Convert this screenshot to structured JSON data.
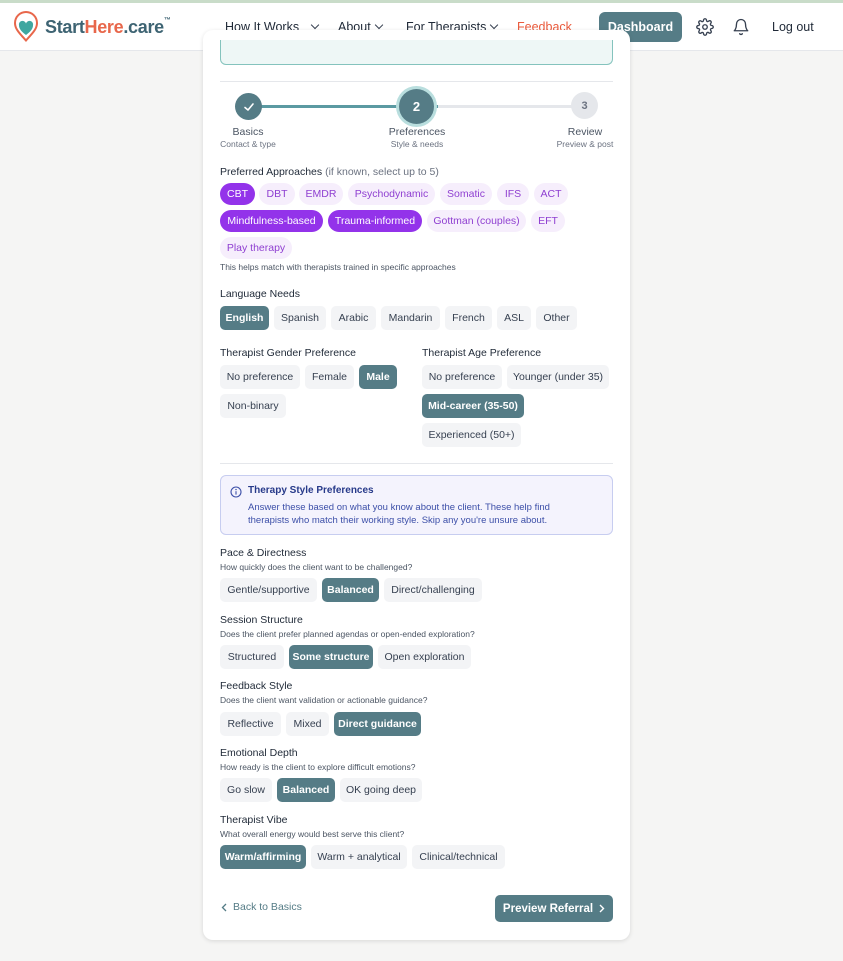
{
  "header": {
    "logo": {
      "start": "Start",
      "here": "Here",
      "care": ".care",
      "tm": "™"
    },
    "nav": {
      "how_it_works": "How It Works",
      "about": "About",
      "for_therapists": "For Therapists",
      "feedback": "Feedback",
      "dashboard": "Dashboard",
      "logout": "Log out"
    },
    "icons": {
      "settings": "gear-icon",
      "notifications": "bell-icon",
      "expand": "chevron-down-icon"
    }
  },
  "colors": {
    "brand_teal": "#557c86",
    "accent_coral": "#ea5a3c",
    "purple": "#9333ea"
  },
  "stepper": {
    "steps": [
      {
        "number": "1",
        "title": "Basics",
        "subtitle": "Contact & type",
        "state": "complete"
      },
      {
        "number": "2",
        "title": "Preferences",
        "subtitle": "Style & needs",
        "state": "active"
      },
      {
        "number": "3",
        "title": "Review",
        "subtitle": "Preview & post",
        "state": "upcoming"
      }
    ]
  },
  "approaches": {
    "label": "Preferred Approaches",
    "label_hint": "(if known, select up to 5)",
    "help": "This helps match with therapists trained in specific approaches",
    "options": [
      {
        "label": "CBT",
        "selected": true
      },
      {
        "label": "DBT",
        "selected": false
      },
      {
        "label": "EMDR",
        "selected": false
      },
      {
        "label": "Psychodynamic",
        "selected": false
      },
      {
        "label": "Somatic",
        "selected": false
      },
      {
        "label": "IFS",
        "selected": false
      },
      {
        "label": "ACT",
        "selected": false
      },
      {
        "label": "Mindfulness-based",
        "selected": true
      },
      {
        "label": "Trauma-informed",
        "selected": true
      },
      {
        "label": "Gottman (couples)",
        "selected": false
      },
      {
        "label": "EFT",
        "selected": false
      },
      {
        "label": "Play therapy",
        "selected": false
      }
    ]
  },
  "language": {
    "label": "Language Needs",
    "options": [
      {
        "label": "English",
        "selected": true
      },
      {
        "label": "Spanish",
        "selected": false
      },
      {
        "label": "Arabic",
        "selected": false
      },
      {
        "label": "Mandarin",
        "selected": false
      },
      {
        "label": "French",
        "selected": false
      },
      {
        "label": "ASL",
        "selected": false
      },
      {
        "label": "Other",
        "selected": false
      }
    ]
  },
  "gender": {
    "label": "Therapist Gender Preference",
    "options": [
      {
        "label": "No preference",
        "selected": false
      },
      {
        "label": "Female",
        "selected": false
      },
      {
        "label": "Male",
        "selected": true
      },
      {
        "label": "Non-binary",
        "selected": false
      }
    ]
  },
  "age": {
    "label": "Therapist Age Preference",
    "options": [
      {
        "label": "No preference",
        "selected": false
      },
      {
        "label": "Younger (under 35)",
        "selected": false
      },
      {
        "label": "Mid-career (35-50)",
        "selected": true
      },
      {
        "label": "Experienced (50+)",
        "selected": false
      }
    ]
  },
  "style_info": {
    "icon": "info-icon",
    "title": "Therapy Style Preferences",
    "body": "Answer these based on what you know about the client. These help find therapists who match their working style. Skip any you're unsure about."
  },
  "style_questions": [
    {
      "label": "Pace & Directness",
      "question": "How quickly does the client want to be challenged?",
      "options": [
        {
          "label": "Gentle/supportive",
          "selected": false
        },
        {
          "label": "Balanced",
          "selected": true
        },
        {
          "label": "Direct/challenging",
          "selected": false
        }
      ]
    },
    {
      "label": "Session Structure",
      "question": "Does the client prefer planned agendas or open-ended exploration?",
      "options": [
        {
          "label": "Structured",
          "selected": false
        },
        {
          "label": "Some structure",
          "selected": true
        },
        {
          "label": "Open exploration",
          "selected": false
        }
      ]
    },
    {
      "label": "Feedback Style",
      "question": "Does the client want validation or actionable guidance?",
      "options": [
        {
          "label": "Reflective",
          "selected": false
        },
        {
          "label": "Mixed",
          "selected": false
        },
        {
          "label": "Direct guidance",
          "selected": true
        }
      ]
    },
    {
      "label": "Emotional Depth",
      "question": "How ready is the client to explore difficult emotions?",
      "options": [
        {
          "label": "Go slow",
          "selected": false
        },
        {
          "label": "Balanced",
          "selected": true
        },
        {
          "label": "OK going deep",
          "selected": false
        }
      ]
    },
    {
      "label": "Therapist Vibe",
      "question": "What overall energy would best serve this client?",
      "options": [
        {
          "label": "Warm/affirming",
          "selected": true
        },
        {
          "label": "Warm + analytical",
          "selected": false
        },
        {
          "label": "Clinical/technical",
          "selected": false
        }
      ]
    }
  ],
  "footer": {
    "back_label": "Back to Basics",
    "next_label": "Preview Referral"
  }
}
